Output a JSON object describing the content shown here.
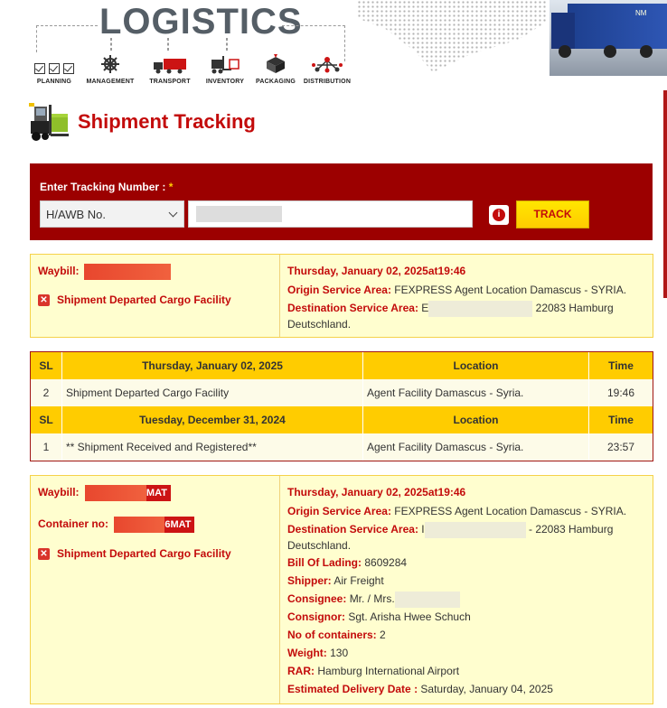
{
  "header": {
    "brand": "LOGISTICS",
    "icons": [
      {
        "label": "PLANNING",
        "icon": "checkbox-icon"
      },
      {
        "label": "MANAGEMENT",
        "icon": "ship-wheel-icon"
      },
      {
        "label": "TRANSPORT",
        "icon": "truck-icon"
      },
      {
        "label": "INVENTORY",
        "icon": "forklift-icon"
      },
      {
        "label": "PACKAGING",
        "icon": "box-icon"
      },
      {
        "label": "DISTRIBUTION",
        "icon": "network-icon"
      }
    ],
    "truck_label": "NM"
  },
  "page": {
    "title": "Shipment Tracking"
  },
  "tracking_form": {
    "label": "Enter Tracking Number :",
    "required_mark": "*",
    "select_value": "H/AWB No.",
    "track_button": "TRACK",
    "info_glyph": "i"
  },
  "result1": {
    "waybill_label": "Waybill:",
    "status": "Shipment Departed Cargo Facility",
    "date": "Thursday, January 02, 2025at19:46",
    "origin_label": "Origin Service Area:",
    "origin_value": "FEXPRESS Agent Location Damascus - SYRIA.",
    "dest_label": "Destination Service Area:",
    "dest_prefix": "E",
    "dest_suffix": "22083 Hamburg",
    "dest_country": "Deutschland."
  },
  "history": {
    "groups": [
      {
        "sl_header": "SL",
        "date_header": "Thursday, January 02, 2025",
        "location_header": "Location",
        "time_header": "Time",
        "rows": [
          {
            "sl": "2",
            "event": "Shipment Departed Cargo Facility",
            "location": "Agent Facility Damascus - Syria.",
            "time": "19:46"
          }
        ]
      },
      {
        "sl_header": "SL",
        "date_header": "Tuesday, December 31, 2024",
        "location_header": "Location",
        "time_header": "Time",
        "rows": [
          {
            "sl": "1",
            "event": "** Shipment Received and Registered**",
            "location": "Agent Facility Damascus - Syria.",
            "time": "23:57"
          }
        ]
      }
    ]
  },
  "result2": {
    "waybill_label": "Waybill:",
    "waybill_suffix": "MAT",
    "container_label": "Container no:",
    "container_suffix": "6MAT",
    "status": "Shipment Departed Cargo Facility",
    "date": "Thursday, January 02, 2025at19:46",
    "origin_label": "Origin Service Area:",
    "origin_value": "FEXPRESS Agent Location Damascus - SYRIA.",
    "dest_label": "Destination Service Area:",
    "dest_prefix": "I",
    "dest_suffix": "- 22083 Hamburg",
    "dest_country": "Deutschland.",
    "details": [
      {
        "label": "Bill Of Lading:",
        "value": "8609284"
      },
      {
        "label": "Shipper:",
        "value": "Air Freight"
      },
      {
        "label": "Consignee:",
        "value": "Mr. / Mrs."
      },
      {
        "label": "Consignor:",
        "value": "Sgt. Arisha Hwee Schuch"
      },
      {
        "label": "No of containers:",
        "value": "2"
      },
      {
        "label": "Weight:",
        "value": "130"
      },
      {
        "label": "RAR:",
        "value": "Hamburg International Airport"
      },
      {
        "label": "Estimated Delivery Date :",
        "value": "Saturday, January 04, 2025"
      }
    ]
  },
  "colors": {
    "brand_red": "#c30b0b",
    "panel_red": "#9c0000",
    "accent_yellow": "#ffcc00",
    "result_bg": "#fffecf"
  }
}
